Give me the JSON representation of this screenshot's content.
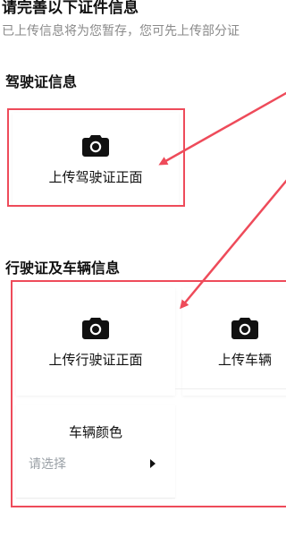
{
  "header": {
    "title": "请完善以下证件信息",
    "subtitle": "已上传信息将为您暂存，您可先上传部分证"
  },
  "sections": {
    "driver_license": {
      "title": "驾驶证信息",
      "upload_front_label": "上传驾驶证正面",
      "icon": "camera-icon"
    },
    "vehicle": {
      "title": "行驶证及车辆信息",
      "upload_front_label": "上传行驶证正面",
      "upload_vehicle_label": "上传车辆",
      "color_title": "车辆颜色",
      "color_placeholder": "请选择",
      "icon": "camera-icon"
    }
  },
  "colors": {
    "annotation_red": "#ee4b5a",
    "text_primary": "#111111",
    "text_secondary": "#8a8a8a",
    "placeholder": "#9aa0a6"
  }
}
